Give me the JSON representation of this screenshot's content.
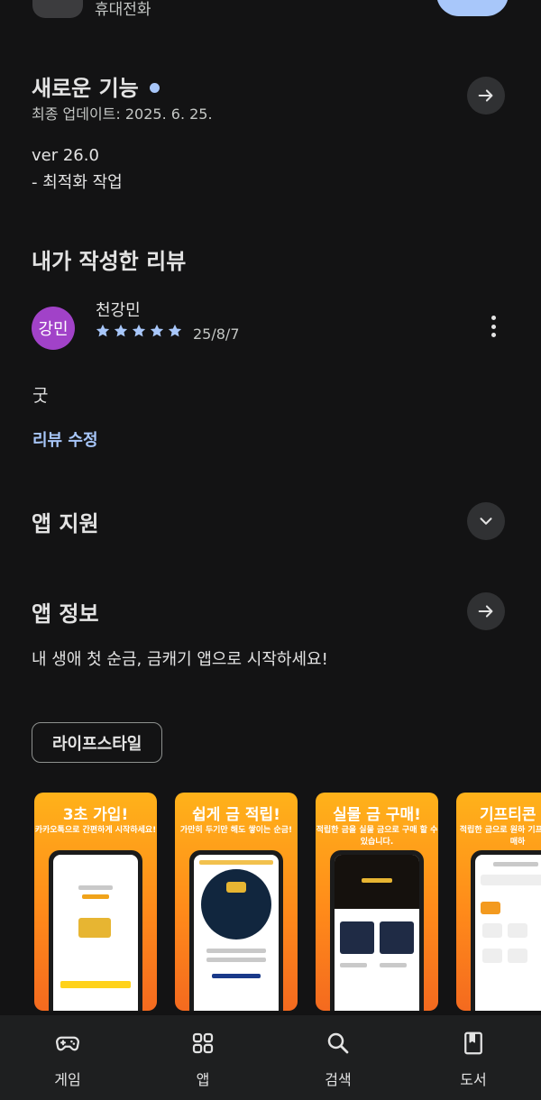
{
  "header": {
    "device_label": "휴대전화"
  },
  "whats_new": {
    "title": "새로운 기능",
    "updated": "최종 업데이트: 2025. 6. 25.",
    "version": "ver 26.0",
    "note": "- 최적화 작업"
  },
  "my_review": {
    "title": "내가 작성한 리뷰",
    "avatar_text": "강민",
    "name": "천강민",
    "rating": 5,
    "date": "25/8/7",
    "body": "굿",
    "edit_label": "리뷰 수정"
  },
  "app_support": {
    "title": "앱 지원"
  },
  "app_info": {
    "title": "앱 정보",
    "description": "내 생애 첫 순금, 금캐기 앱으로 시작하세요!",
    "category_chip": "라이프스타일"
  },
  "screenshots": [
    {
      "title": "3초 가입!",
      "caption": "카카오톡으로 간편하게 시작하세요!"
    },
    {
      "title": "쉽게 금 적립!",
      "caption": "가만히 두기만 해도 쌓이는 순금!"
    },
    {
      "title": "실물 금 구매!",
      "caption": "적립한 금을 실물 금으로 구매 할 수 있습니다."
    },
    {
      "title": "기프티콘 구",
      "caption": "적립한 금으로 원하 기프티콘을 구매하"
    }
  ],
  "bottom_nav": [
    {
      "label": "게임",
      "icon": "gamepad-icon"
    },
    {
      "label": "앱",
      "icon": "apps-grid-icon"
    },
    {
      "label": "검색",
      "icon": "search-icon"
    },
    {
      "label": "도서",
      "icon": "book-icon"
    }
  ],
  "colors": {
    "background": "#131314",
    "accent": "#a8c7fa",
    "avatar": "#a142c8",
    "star": "#a8c7fa",
    "promo_orange": "#ff8a1a"
  }
}
